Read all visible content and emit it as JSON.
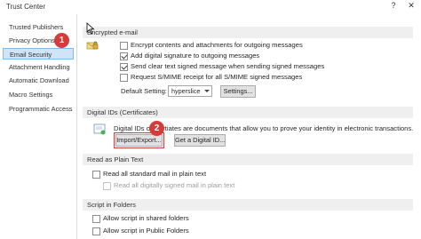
{
  "window": {
    "title": "Trust Center",
    "help_label": "?",
    "close_label": "✕"
  },
  "sidebar": {
    "items": [
      {
        "label": "Trusted Publishers"
      },
      {
        "label": "Privacy Options"
      },
      {
        "label": "Email Security",
        "selected": true
      },
      {
        "label": "Attachment Handling"
      },
      {
        "label": "Automatic Download"
      },
      {
        "label": "Macro Settings"
      },
      {
        "label": "Programmatic Access"
      }
    ]
  },
  "encrypted": {
    "header": "Encrypted e-mail",
    "options": [
      {
        "label": "Encrypt contents and attachments for outgoing messages",
        "checked": false
      },
      {
        "label": "Add digital signature to outgoing messages",
        "checked": true
      },
      {
        "label": "Send clear text signed message when sending signed messages",
        "checked": true
      },
      {
        "label": "Request S/MIME receipt for all S/MIME signed messages",
        "checked": false
      }
    ],
    "default_setting_label": "Default Setting:",
    "default_setting_value": "hyperslice",
    "settings_button": "Settings..."
  },
  "digital_ids": {
    "header": "Digital IDs (Certificates)",
    "desc_before": "Digital IDs or Certi",
    "desc_after": "ates are documents that allow you to prove your identity in electronic transactions.",
    "import_export_button": "Import/Export...",
    "get_id_button": "Get a Digital ID..."
  },
  "plain_text": {
    "header": "Read as Plain Text",
    "options": [
      {
        "label": "Read all standard mail in plain text",
        "checked": false,
        "disabled": false
      },
      {
        "label": "Read all digitally signed mail in plain text",
        "checked": false,
        "disabled": true
      }
    ]
  },
  "script": {
    "header": "Script in Folders",
    "options": [
      {
        "label": "Allow script in shared folders",
        "checked": false
      },
      {
        "label": "Allow script in Public Folders",
        "checked": false
      }
    ]
  },
  "callouts": {
    "one": "1",
    "two": "2"
  },
  "colors": {
    "callout_red": "#d63a3a",
    "selected_bg": "#cfe4f7",
    "section_bg": "#efefef"
  }
}
